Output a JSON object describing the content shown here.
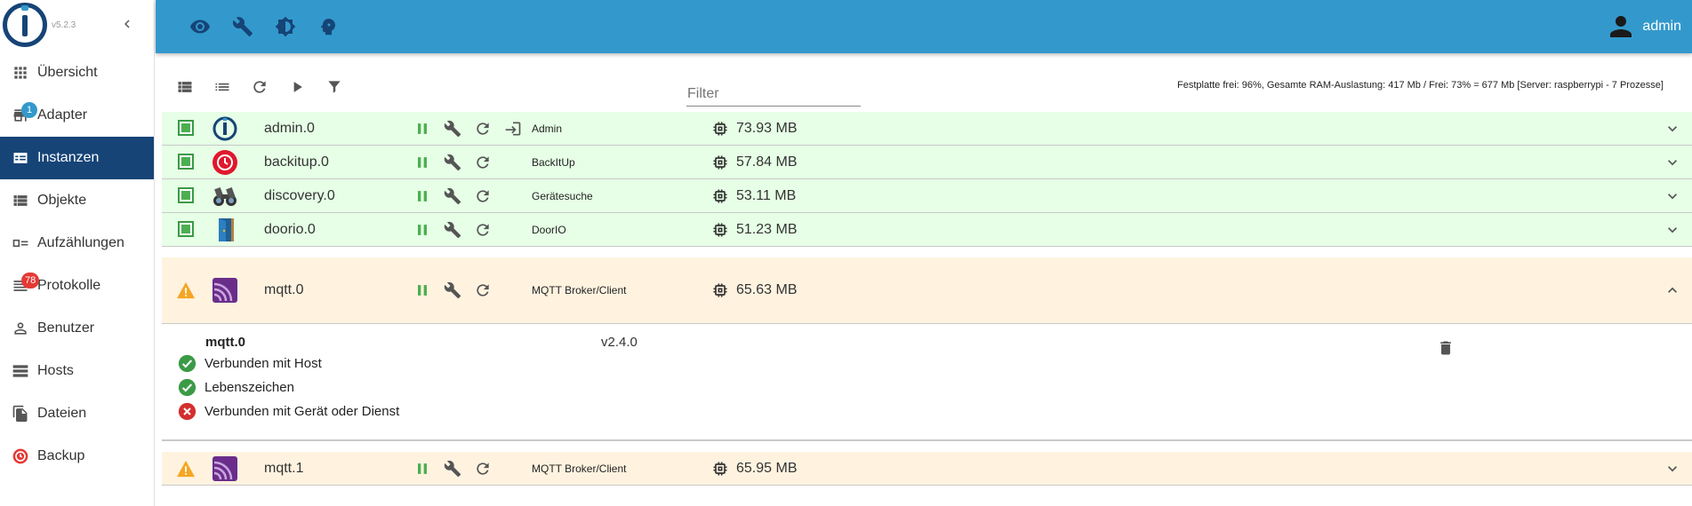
{
  "app": {
    "version": "v5.2.3"
  },
  "colors": {
    "primary": "#164477",
    "accent": "#3399cc",
    "green_row": "#e6ffe6",
    "orange_row": "#fff3e0",
    "badge_blue": "#3399cc",
    "badge_red": "#e53935"
  },
  "sidebar": {
    "items": [
      {
        "label": "Übersicht",
        "icon": "apps-grid-icon",
        "badge": ""
      },
      {
        "label": "Adapter",
        "icon": "store-icon",
        "badge": "1"
      },
      {
        "label": "Instanzen",
        "icon": "instances-icon",
        "badge": ""
      },
      {
        "label": "Objekte",
        "icon": "list-icon",
        "badge": ""
      },
      {
        "label": "Aufzählungen",
        "icon": "enum-icon",
        "badge": ""
      },
      {
        "label": "Protokolle",
        "icon": "log-icon",
        "badge": "78"
      },
      {
        "label": "Benutzer",
        "icon": "person-icon",
        "badge": ""
      },
      {
        "label": "Hosts",
        "icon": "hosts-icon",
        "badge": ""
      },
      {
        "label": "Dateien",
        "icon": "files-icon",
        "badge": ""
      },
      {
        "label": "Backup",
        "icon": "backup-icon",
        "badge": ""
      }
    ],
    "active": "Instanzen"
  },
  "topbar": {
    "icons": [
      "eye-icon",
      "wrench-icon",
      "theme-icon",
      "expert-mode-icon"
    ],
    "user": "admin"
  },
  "toolbar": {
    "icons": [
      "compact-view-icon",
      "list-view-icon",
      "refresh-icon",
      "play-icon",
      "filter-icon"
    ],
    "filter_placeholder": "Filter",
    "sysinfo": "Festplatte frei: 96%, Gesamte RAM-Auslastung: 417 Mb / Frei: 73% = 677 Mb [Server: raspberrypi - 7 Prozesse]"
  },
  "instances": [
    {
      "name": "admin.0",
      "title": "Admin",
      "memory": "73.93 MB",
      "state": "ok",
      "icon": "iobroker-icon"
    },
    {
      "name": "backitup.0",
      "title": "BackItUp",
      "memory": "57.84 MB",
      "state": "ok",
      "icon": "backitup-icon"
    },
    {
      "name": "discovery.0",
      "title": "Gerätesuche",
      "memory": "53.11 MB",
      "state": "ok",
      "icon": "binoculars-icon"
    },
    {
      "name": "doorio.0",
      "title": "DoorIO",
      "memory": "51.23 MB",
      "state": "ok",
      "icon": "door-icon"
    },
    {
      "name": "mqtt.0",
      "title": "MQTT Broker/Client",
      "memory": "65.63 MB",
      "state": "warning",
      "icon": "mqtt-icon"
    },
    {
      "name": "mqtt.1",
      "title": "MQTT Broker/Client",
      "memory": "65.95 MB",
      "state": "warning",
      "icon": "mqtt-icon"
    }
  ],
  "details": {
    "name": "mqtt.0",
    "version": "v2.4.0",
    "statuses": [
      {
        "label": "Verbunden mit Host",
        "ok": true
      },
      {
        "label": "Lebenszeichen",
        "ok": true
      },
      {
        "label": "Verbunden mit Gerät oder Dienst",
        "ok": false
      }
    ]
  }
}
